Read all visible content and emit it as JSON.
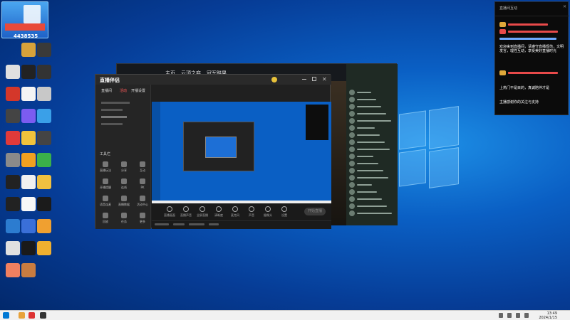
{
  "desktop": {
    "tile_number": "4438535",
    "icon_colors": [
      "#e8e8e8",
      "#d7a23b",
      "#3a3a3a",
      "#e0e0e0",
      "#222",
      "#333",
      "#d4372a",
      "#f4f4f4",
      "#c8c8c8",
      "#444",
      "#7b5cf0",
      "#3aa0e8",
      "#e03a3a",
      "#f0c33c",
      "#444",
      "#8a8a8a",
      "#f0a020",
      "#3ab14a",
      "#222",
      "#f0f0f0",
      "#f0c040",
      "#222",
      "#f8f8f8",
      "#1b1b1b",
      "#2c7cd0",
      "#3a6fd8",
      "#f0a030",
      "#e0e0e0",
      "#1a1a1a",
      "#f0b030",
      "#f08060",
      "#c87c40"
    ]
  },
  "browser": {
    "nav": [
      "主页",
      "云顶之弈",
      "冠军鲜果"
    ]
  },
  "app": {
    "logo": "直播伴侣",
    "tabs": [
      "直播间",
      "活动",
      "开播设置"
    ],
    "tools_heading": "工具栏",
    "tools": [
      "直播玩法",
      "分享",
      "互动",
      "开播提醒",
      "连线",
      "PK",
      "语音连麦",
      "直播数据",
      "活动中心",
      "回放",
      "任务",
      "更多"
    ],
    "controls": [
      "直播画面",
      "直播声音",
      "全屏直播",
      "清晰度",
      "麦克风",
      "声音",
      "摄像头",
      "设置"
    ],
    "go_live": "开始直播"
  },
  "panel": {
    "title": "直播间互动",
    "messages": [
      "欢迎来到直播间，请遵守直播规范，文明发言，理性互动，享受美好直播时光",
      "上热门不是目的，真诚陪伴才是",
      "主播感谢你的关注与支持"
    ]
  },
  "taskbar": {
    "time": "13:49",
    "date": "2024/1/15"
  }
}
